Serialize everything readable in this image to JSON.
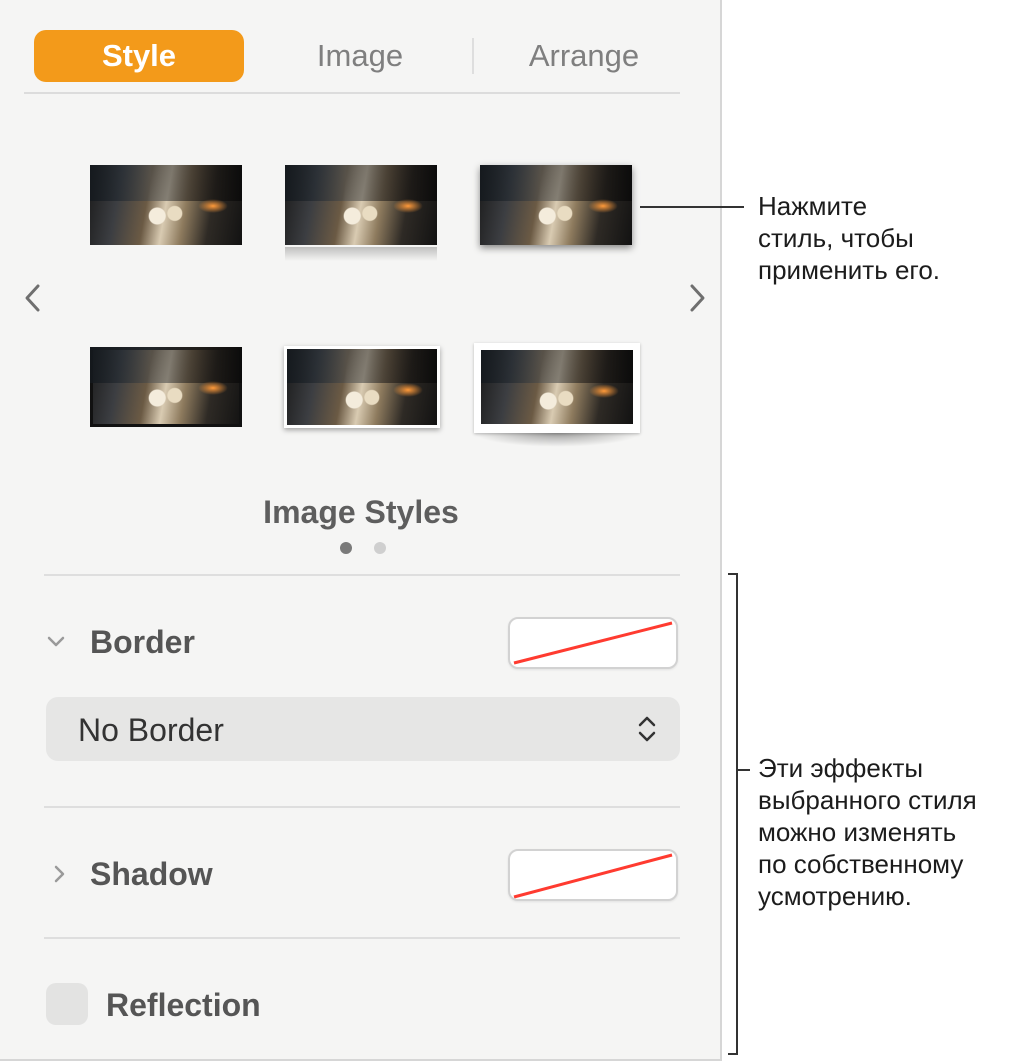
{
  "tabs": [
    {
      "label": "Style",
      "active": true
    },
    {
      "label": "Image",
      "active": false
    },
    {
      "label": "Arrange",
      "active": false
    }
  ],
  "style_presets": {
    "title": "Image Styles",
    "page_count": 2,
    "current_page": 1,
    "items": [
      {
        "name": "plain"
      },
      {
        "name": "reflection"
      },
      {
        "name": "drop-shadow"
      },
      {
        "name": "black-frame"
      },
      {
        "name": "white-frame"
      },
      {
        "name": "curled-shadow"
      }
    ]
  },
  "border": {
    "label": "Border",
    "expanded": true,
    "dropdown_value": "No Border",
    "swatch": "none"
  },
  "shadow": {
    "label": "Shadow",
    "expanded": false,
    "swatch": "none"
  },
  "reflection": {
    "label": "Reflection",
    "checked": false
  },
  "callouts": {
    "styles": [
      "Нажмите",
      "стиль, чтобы",
      "применить его."
    ],
    "effects": [
      "Эти эффекты",
      "выбранного стиля",
      "можно изменять",
      "по собственному",
      "усмотрению."
    ]
  },
  "colors": {
    "accent": "#f39a1a",
    "no_color_slash": "#ff3b30",
    "panel_bg": "#f5f5f4"
  },
  "icons": {
    "prev": "chevron-left-icon",
    "next": "chevron-right-icon",
    "border_toggle": "chevron-down-icon",
    "shadow_toggle": "chevron-right-icon",
    "dropdown": "up-down-chevron-icon"
  }
}
